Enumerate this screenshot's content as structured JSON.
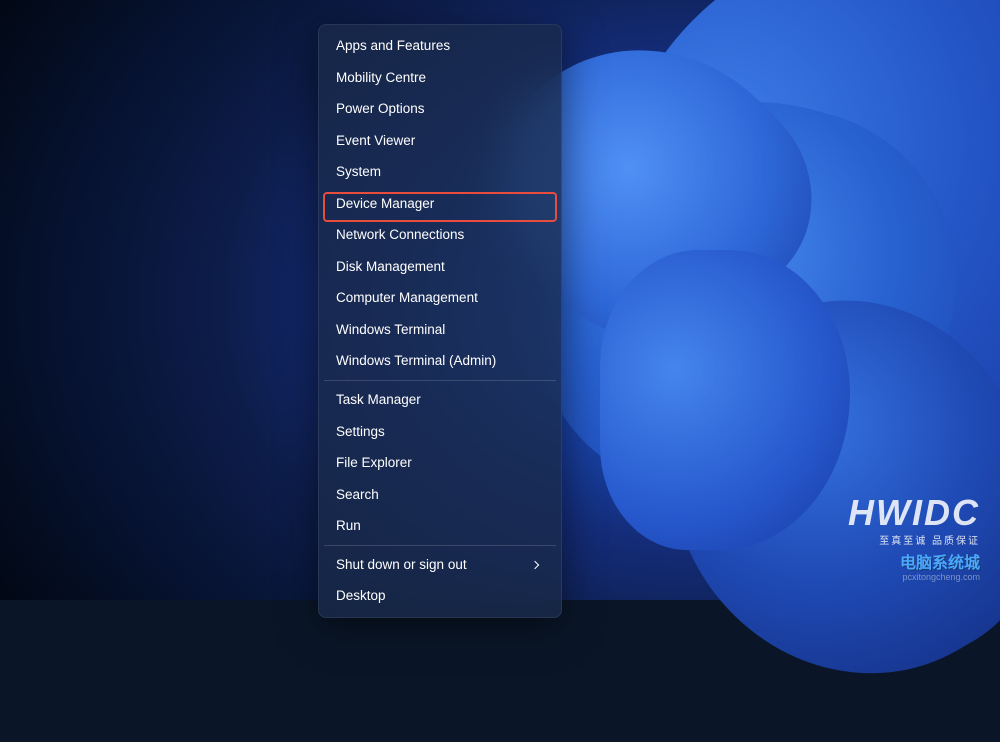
{
  "menu": {
    "group1": [
      "Apps and Features",
      "Mobility Centre",
      "Power Options",
      "Event Viewer",
      "System",
      "Device Manager",
      "Network Connections",
      "Disk Management",
      "Computer Management",
      "Windows Terminal",
      "Windows Terminal (Admin)"
    ],
    "group2": [
      "Task Manager",
      "Settings",
      "File Explorer",
      "Search",
      "Run"
    ],
    "group3_submenu": "Shut down or sign out",
    "group3_last": "Desktop"
  },
  "highlighted_item": "Device Manager",
  "watermark": {
    "main": "HWIDC",
    "sub": "至真至诚 品质保证",
    "cn": "电脑系统城",
    "url": "pcxitongcheng.com"
  }
}
